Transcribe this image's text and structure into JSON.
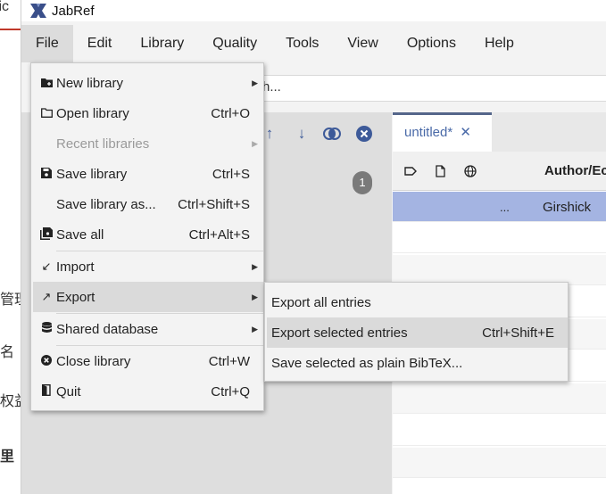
{
  "background_window": {
    "lines": [
      "tic",
      "管理",
      "名",
      "权益",
      "里"
    ]
  },
  "app": {
    "title": "JabRef",
    "menus": [
      "File",
      "Edit",
      "Library",
      "Quality",
      "Tools",
      "View",
      "Options",
      "Help"
    ],
    "search_placeholder_tail": "h...",
    "badge_count": "1",
    "tab_label": "untitled*",
    "tab_close": "✕",
    "column_author": "Author/Ec",
    "selected_row": {
      "dots": "...",
      "author": "Girshick"
    }
  },
  "file_menu": {
    "items": [
      {
        "label": "New library",
        "shortcut": "",
        "submenu": true,
        "icon": "new-library-icon",
        "disabled": false
      },
      {
        "label": "Open library",
        "shortcut": "Ctrl+O",
        "submenu": false,
        "icon": "folder-icon",
        "disabled": false
      },
      {
        "label": "Recent libraries",
        "shortcut": "",
        "submenu": true,
        "icon": "",
        "disabled": true
      },
      {
        "label": "Save library",
        "shortcut": "Ctrl+S",
        "submenu": false,
        "icon": "save-icon",
        "disabled": false
      },
      {
        "label": "Save library as...",
        "shortcut": "Ctrl+Shift+S",
        "submenu": false,
        "icon": "",
        "disabled": false
      },
      {
        "label": "Save all",
        "shortcut": "Ctrl+Alt+S",
        "submenu": false,
        "icon": "save-all-icon",
        "disabled": false
      },
      {
        "label": "Import",
        "shortcut": "",
        "submenu": true,
        "icon": "import-arrow-icon",
        "disabled": false
      },
      {
        "label": "Export",
        "shortcut": "",
        "submenu": true,
        "icon": "export-arrow-icon",
        "disabled": false
      },
      {
        "label": "Shared database",
        "shortcut": "",
        "submenu": true,
        "icon": "database-icon",
        "disabled": false
      },
      {
        "label": "Close library",
        "shortcut": "Ctrl+W",
        "submenu": false,
        "icon": "close-circle-icon",
        "disabled": false
      },
      {
        "label": "Quit",
        "shortcut": "Ctrl+Q",
        "submenu": false,
        "icon": "quit-door-icon",
        "disabled": false
      }
    ]
  },
  "export_submenu": {
    "items": [
      {
        "label": "Export all entries",
        "shortcut": ""
      },
      {
        "label": "Export selected entries",
        "shortcut": "Ctrl+Shift+E"
      },
      {
        "label": "Save selected as plain BibTeX...",
        "shortcut": ""
      }
    ]
  },
  "colors": {
    "accent_blue": "#4a6aa8",
    "selection": "#a4b4e2",
    "menu_hover": "#dadada"
  }
}
